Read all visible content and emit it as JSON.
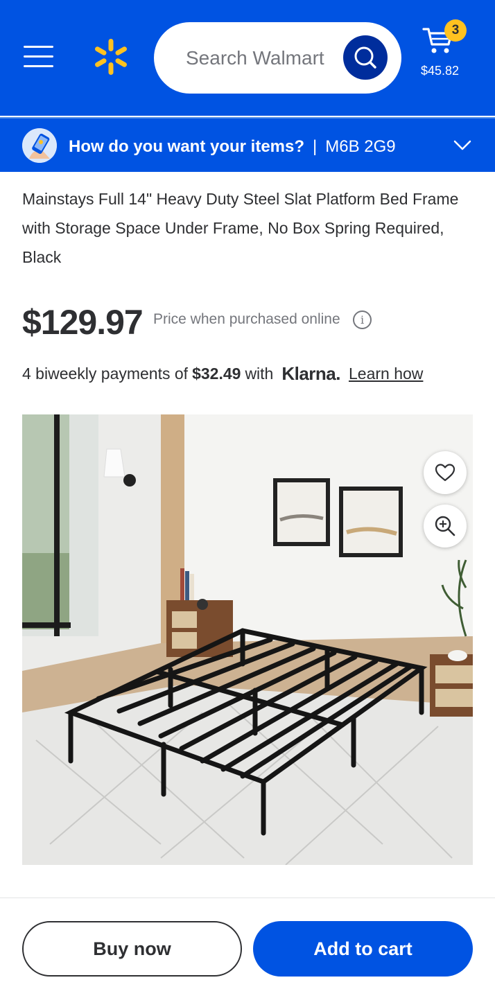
{
  "header": {
    "menu_icon": "hamburger-menu-icon",
    "logo_icon": "walmart-spark-logo",
    "search_placeholder": "Search Walmart",
    "search_icon": "search-icon",
    "cart_icon": "cart-icon",
    "cart_count": "3",
    "cart_total": "$45.82",
    "background_color": "#0053e2",
    "badge_color": "#ffc220"
  },
  "delivery": {
    "prompt": "How do you want your items?",
    "separator": "|",
    "postal_code": "M6B 2G9",
    "chevron_icon": "chevron-down-icon"
  },
  "product": {
    "title": "Mainstays Full 14\" Heavy Duty Steel Slat Platform Bed Frame with Storage Space Under Frame, No Box Spring Required, Black",
    "price": "$129.97",
    "price_note": "Price when purchased online",
    "info_icon": "info-icon",
    "payments_prefix": "4 biweekly payments of",
    "payment_amount": "$32.49",
    "payments_with": "with",
    "klarna_logo": "Klarna.",
    "learn_link": "Learn how",
    "image_alt": "black steel platform bed frame in a bedroom",
    "favorite_icon": "heart-icon",
    "zoom_icon": "zoom-in-icon"
  },
  "actions": {
    "buy_now": "Buy now",
    "add_to_cart": "Add to cart",
    "primary_color": "#0053e2"
  }
}
